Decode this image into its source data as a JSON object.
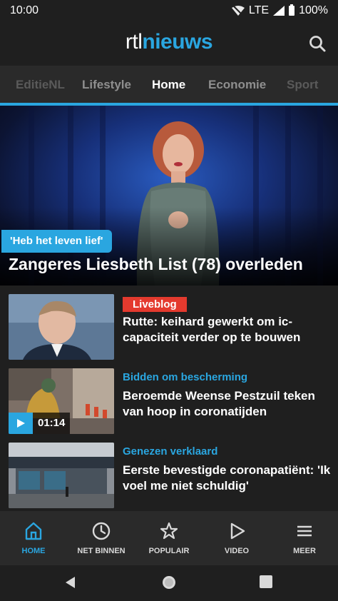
{
  "status_bar": {
    "time": "10:00",
    "network": "LTE",
    "battery": "100%"
  },
  "header": {
    "logo_rtl": "rtl",
    "logo_nieuws": "nieuws"
  },
  "tabs": [
    {
      "label": "EditieNL"
    },
    {
      "label": "Lifestyle"
    },
    {
      "label": "Home",
      "active": true
    },
    {
      "label": "Economie"
    },
    {
      "label": "Sport"
    }
  ],
  "hero": {
    "tag": "'Heb het leven lief'",
    "title": "Zangeres Liesbeth List (78) overleden"
  },
  "articles": [
    {
      "tag": "Liveblog",
      "tag_style": "live",
      "title": "Rutte: keihard gewerkt om ic-capaciteit verder op te bouwen"
    },
    {
      "tag": "Bidden om bescherming",
      "title": "Beroemde Weense Pestzuil teken van hoop in coronatijden",
      "video_duration": "01:14"
    },
    {
      "tag": "Genezen verklaard",
      "title": "Eerste bevestigde coronapatiënt: 'Ik voel me niet schuldig'"
    }
  ],
  "bottom_nav": [
    {
      "label": "HOME",
      "icon": "home-icon",
      "active": true
    },
    {
      "label": "NET BINNEN",
      "icon": "clock-icon"
    },
    {
      "label": "POPULAIR",
      "icon": "star-icon"
    },
    {
      "label": "VIDEO",
      "icon": "play-icon"
    },
    {
      "label": "MEER",
      "icon": "menu-icon"
    }
  ],
  "colors": {
    "accent": "#2aa6e0",
    "live": "#e43a2e",
    "background": "#1f1f1f"
  }
}
